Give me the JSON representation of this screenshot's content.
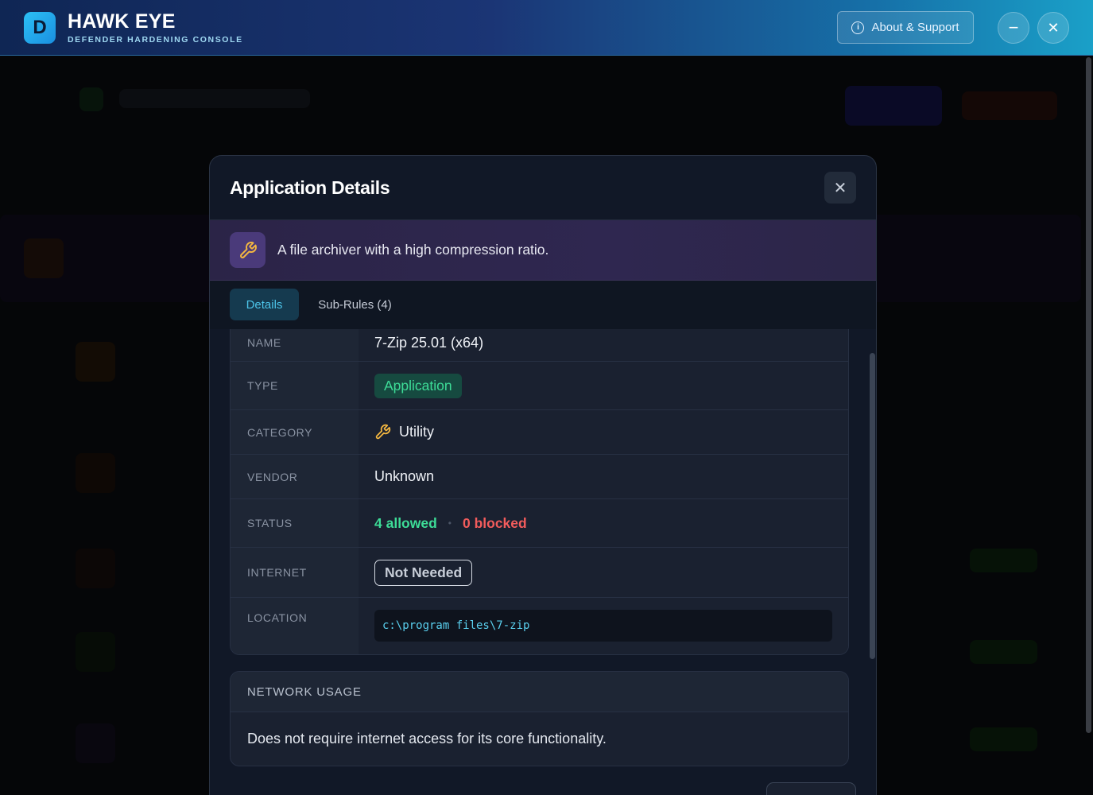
{
  "window": {
    "logo_letter": "D",
    "title": "HAWK EYE",
    "subtitle": "DEFENDER HARDENING CONSOLE",
    "about_label": "About & Support",
    "minimize_symbol": "−",
    "close_symbol": "✕"
  },
  "modal": {
    "title": "Application Details",
    "close_symbol": "✕",
    "description": "A file archiver with a high compression ratio.",
    "description_icon": "wrench-icon",
    "tabs": [
      {
        "label": "Details",
        "active": true
      },
      {
        "label": "Sub-Rules (4)",
        "active": false
      }
    ],
    "details": {
      "name_label": "NAME",
      "name_value": "7-Zip 25.01 (x64)",
      "type_label": "TYPE",
      "type_value": "Application",
      "category_label": "CATEGORY",
      "category_value": "Utility",
      "category_icon": "wrench-icon",
      "vendor_label": "VENDOR",
      "vendor_value": "Unknown",
      "status_label": "STATUS",
      "status_allowed": "4 allowed",
      "status_separator": "•",
      "status_blocked": "0 blocked",
      "internet_label": "INTERNET",
      "internet_value": "Not Needed",
      "location_label": "LOCATION",
      "location_value": "c:\\program files\\7-zip"
    },
    "network": {
      "header": "NETWORK USAGE",
      "text": "Does not require internet access for its core functionality."
    }
  },
  "colors": {
    "accent": "#4cc3e8",
    "allowed": "#3ddc97",
    "blocked": "#f25c5c",
    "banner": "#2b2447"
  }
}
